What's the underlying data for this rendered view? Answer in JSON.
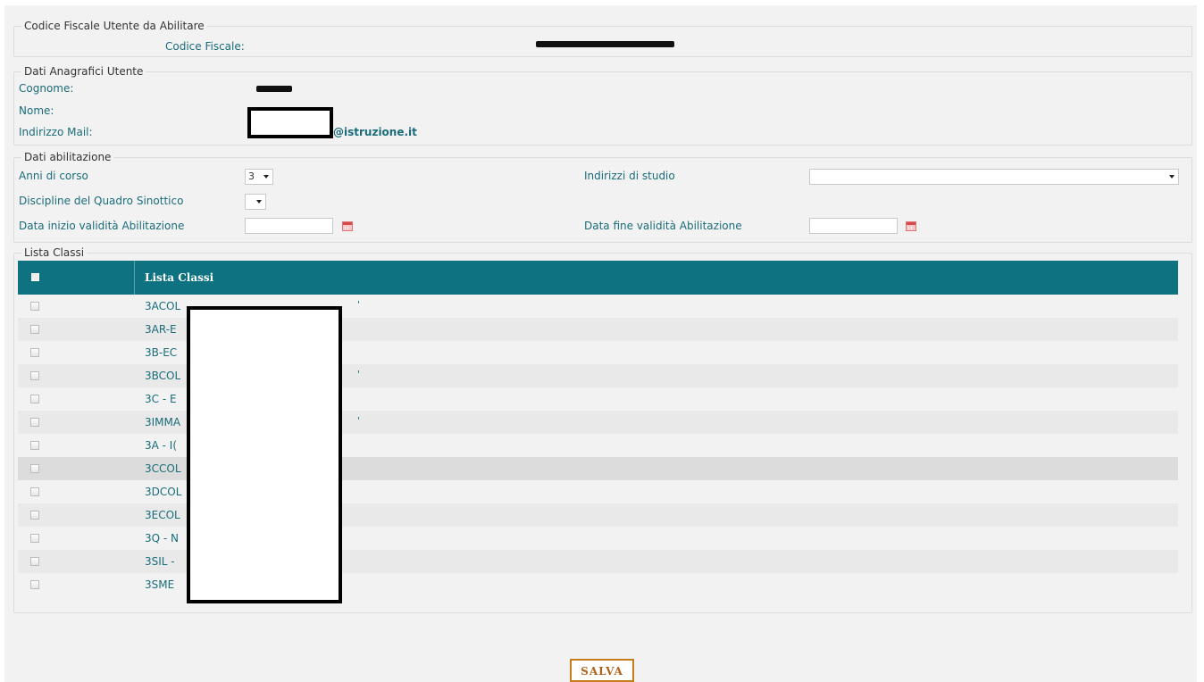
{
  "fieldset_codice": {
    "legend": "Codice Fiscale Utente da Abilitare",
    "codice_fiscale_label": "Codice Fiscale:"
  },
  "fieldset_anagrafici": {
    "legend": "Dati Anagrafici Utente",
    "cognome_label": "Cognome:",
    "nome_label": "Nome:",
    "mail_label": "Indirizzo Mail:",
    "mail_value_visible": "@istruzione.it"
  },
  "fieldset_abilitazione": {
    "legend": "Dati abilitazione",
    "anni_label": "Anni di corso",
    "anni_value": "3",
    "indirizzi_label": "Indirizzi di studio",
    "indirizzi_value": "",
    "discipline_label": "Discipline del Quadro Sinottico",
    "discipline_value": "",
    "data_inizio_label": "Data inizio validità Abilitazione",
    "data_fine_label": "Data fine validità Abilitazione"
  },
  "fieldset_classi": {
    "legend": "Lista Classi",
    "header": "Lista Classi",
    "rows": [
      {
        "prefix": "3ACOL",
        "tick": "'"
      },
      {
        "prefix": "3AR-E",
        "tick": ""
      },
      {
        "prefix": "3B-EC",
        "tick": ""
      },
      {
        "prefix": "3BCOL",
        "tick": "'"
      },
      {
        "prefix": "3C - E",
        "tick": ""
      },
      {
        "prefix": "3IMMA",
        "tick": "'"
      },
      {
        "prefix": "3A - I(",
        "tick": ""
      },
      {
        "prefix": "3CCOL",
        "tick": ""
      },
      {
        "prefix": "3DCOL",
        "tick": ""
      },
      {
        "prefix": "3ECOL",
        "tick": ""
      },
      {
        "prefix": "3Q - N",
        "tick": ""
      },
      {
        "prefix": "3SIL -",
        "tick": ""
      },
      {
        "prefix": "3SME",
        "tick": ""
      }
    ]
  },
  "actions": {
    "save_label": "SALVA"
  },
  "colors": {
    "teal_text": "#1a6c7a",
    "table_header_bg": "#0e7280",
    "button_border": "#c47b1a"
  },
  "icons": [
    "calendar-icon",
    "dropdown-arrow-icon",
    "checkbox-icon"
  ]
}
